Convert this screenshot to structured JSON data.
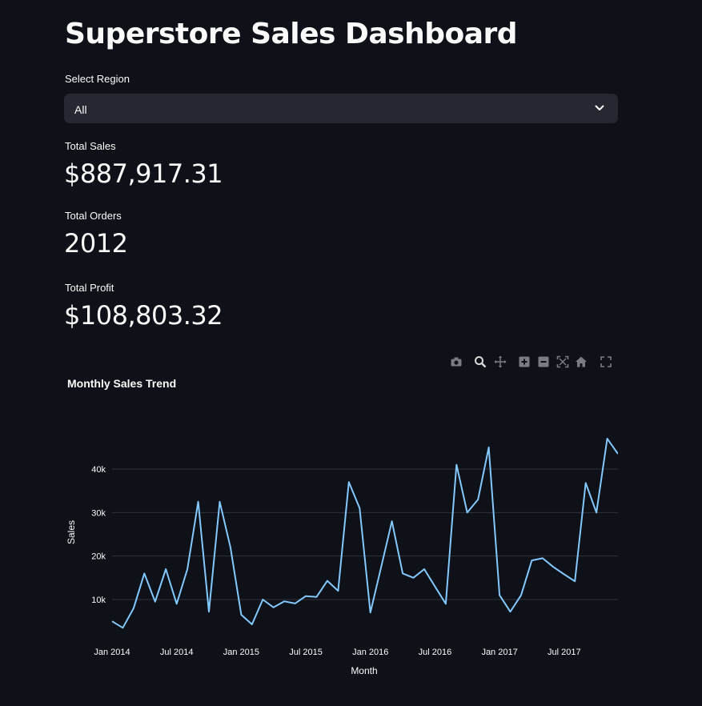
{
  "page": {
    "title": "Superstore Sales Dashboard"
  },
  "region_select": {
    "label": "Select Region",
    "value": "All"
  },
  "metrics": [
    {
      "label": "Total Sales",
      "value": "$887,917.31"
    },
    {
      "label": "Total Orders",
      "value": "2012"
    },
    {
      "label": "Total Profit",
      "value": "$108,803.32"
    }
  ],
  "modebar": {
    "buttons": [
      "camera-icon",
      "zoom-icon",
      "pan-icon",
      "zoom-in-icon",
      "zoom-out-icon",
      "autoscale-icon",
      "reset-axes-icon",
      "fullscreen-icon"
    ]
  },
  "colors": {
    "background": "#0e1117",
    "select_bg": "#262730",
    "line": "#83c9ff",
    "grid": "#31333f",
    "text": "#fafafa"
  },
  "chart_data": {
    "type": "line",
    "title": "Monthly Sales Trend",
    "xlabel": "Month",
    "ylabel": "Sales",
    "ylim": [
      0,
      50000
    ],
    "x_ticks": [
      "Jan 2014",
      "Jul 2014",
      "Jan 2015",
      "Jul 2015",
      "Jan 2016",
      "Jul 2016",
      "Jan 2017",
      "Jul 2017"
    ],
    "y_ticks": [
      "10k",
      "20k",
      "30k",
      "40k"
    ],
    "grid": true,
    "series": [
      {
        "x": [
          "2014-01",
          "2014-02",
          "2014-03",
          "2014-04",
          "2014-05",
          "2014-06",
          "2014-07",
          "2014-08",
          "2014-09",
          "2014-10",
          "2014-11",
          "2014-12",
          "2015-01",
          "2015-02",
          "2015-03",
          "2015-04",
          "2015-05",
          "2015-06",
          "2015-07",
          "2015-08",
          "2015-09",
          "2015-10",
          "2015-11",
          "2015-12",
          "2016-01",
          "2016-02",
          "2016-03",
          "2016-04",
          "2016-05",
          "2016-06",
          "2016-07",
          "2016-08",
          "2016-09",
          "2016-10",
          "2016-11",
          "2016-12",
          "2017-01",
          "2017-02",
          "2017-03",
          "2017-04",
          "2017-05",
          "2017-06",
          "2017-07",
          "2017-08",
          "2017-09",
          "2017-10",
          "2017-11",
          "2017-12"
        ],
        "values": [
          5000,
          3500,
          8000,
          16000,
          9500,
          17000,
          9000,
          17000,
          32500,
          7200,
          32500,
          22000,
          6500,
          4300,
          10000,
          8200,
          9600,
          9100,
          10800,
          10600,
          14300,
          12000,
          37000,
          31000,
          7000,
          17500,
          28000,
          16000,
          15000,
          17000,
          13000,
          9000,
          41000,
          30000,
          33000,
          45000,
          11000,
          7200,
          11000,
          19000,
          19500,
          17500,
          15800,
          14200,
          36800,
          30000,
          47000,
          43500
        ]
      }
    ]
  }
}
